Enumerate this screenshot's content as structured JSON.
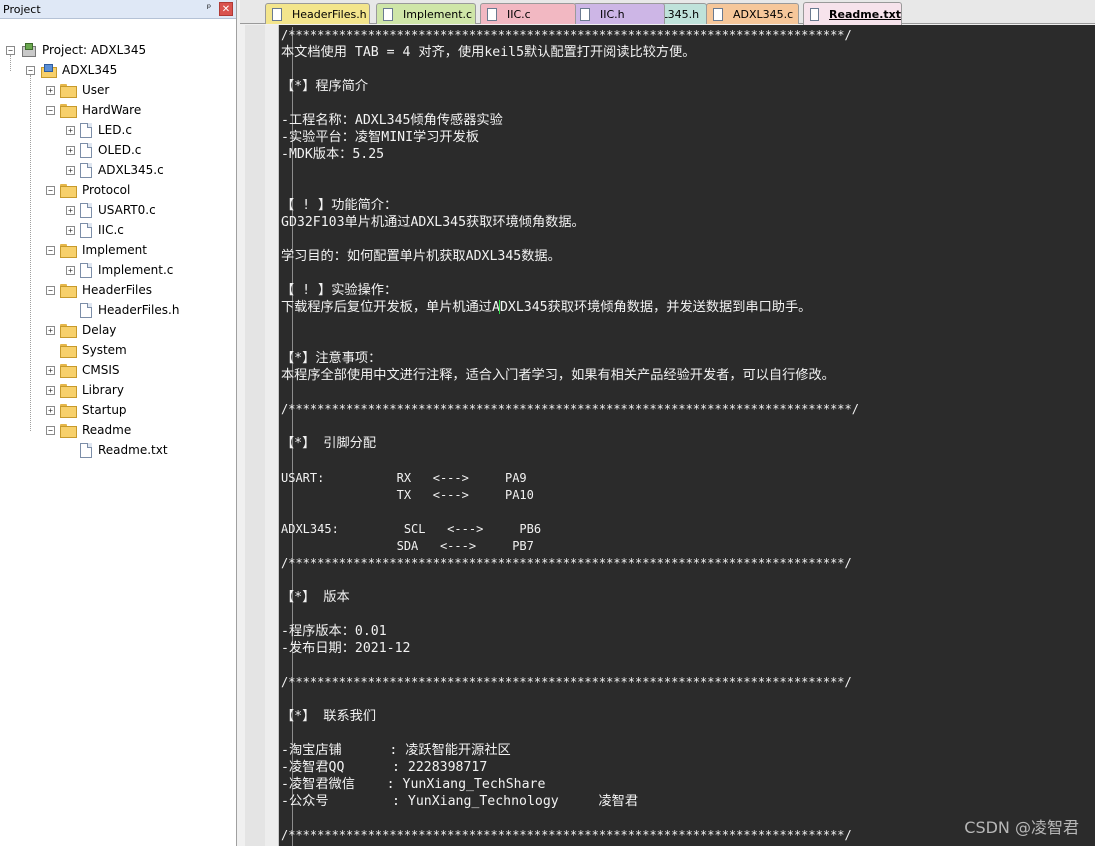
{
  "project_panel": {
    "title": "Project",
    "pin_glyph": "ᵖ",
    "close_glyph": "✕",
    "root_label": "Project: ADXL345",
    "target_label": "ADXL345",
    "groups": [
      {
        "label": "User",
        "state": "collapsed",
        "files": []
      },
      {
        "label": "HardWare",
        "state": "expanded",
        "files": [
          "LED.c",
          "OLED.c",
          "ADXL345.c"
        ]
      },
      {
        "label": "Protocol",
        "state": "expanded",
        "files": [
          "USART0.c",
          "IIC.c"
        ]
      },
      {
        "label": "Implement",
        "state": "expanded",
        "files": [
          "Implement.c"
        ]
      },
      {
        "label": "HeaderFiles",
        "state": "expanded",
        "files": [
          "HeaderFiles.h"
        ]
      },
      {
        "label": "Delay",
        "state": "collapsed",
        "files": []
      },
      {
        "label": "System",
        "state": "none",
        "files": []
      },
      {
        "label": "CMSIS",
        "state": "collapsed",
        "files": []
      },
      {
        "label": "Library",
        "state": "collapsed",
        "files": []
      },
      {
        "label": "Startup",
        "state": "collapsed",
        "files": []
      },
      {
        "label": "Readme",
        "state": "expanded",
        "files": [
          "Readme.txt"
        ]
      }
    ]
  },
  "tabs": [
    {
      "label": "HeaderFiles.h",
      "color": "#f3e58c",
      "active": false
    },
    {
      "label": "Implement.c",
      "color": "#cfe6a8",
      "active": false
    },
    {
      "label": "IIC.c",
      "color": "#f2b8c2",
      "active": false
    },
    {
      "label": "IIC.h",
      "color": "#cdb6e6",
      "active": false
    },
    {
      "label": "ADXL345.h",
      "color": "#bfe2da",
      "active": false
    },
    {
      "label": "ADXL345.c",
      "color": "#f6c79a",
      "active": false
    },
    {
      "label": "Readme.txt",
      "color": "#f7e3ec",
      "active": true
    }
  ],
  "editor": {
    "lines": [
      "/*****************************************************************************/",
      "本文档使用 TAB = 4 对齐，使用keil5默认配置打开阅读比较方便。",
      "",
      "【*】程序简介",
      "",
      "-工程名称：ADXL345倾角传感器实验",
      "-实验平台：凌智MINI学习开发板",
      "-MDK版本：5.25",
      "",
      "",
      "【 ! 】功能简介：",
      "GD32F103单片机通过ADXL345获取环境倾角数据。",
      "",
      "学习目的：如何配置单片机获取ADXL345数据。",
      "",
      "【 ! 】实验操作：",
      "下载程序后复位开发板，单片机通过ADXL345获取环境倾角数据，并发送数据到串口助手。",
      "",
      "",
      "【*】注意事项：",
      "本程序全部使用中文进行注释，适合入门者学习，如果有相关产品经验开发者，可以自行修改。",
      "",
      "/******************************************************************************/",
      "",
      "【*】 引脚分配",
      "",
      "USART:          RX   <--->     PA9",
      "                TX   <--->     PA10",
      "",
      "ADXL345:         SCL   <--->     PB6",
      "                SDA   <--->     PB7",
      "/*****************************************************************************/",
      "",
      "【*】 版本",
      "",
      "-程序版本：0.01",
      "-发布日期：2021-12",
      "",
      "/*****************************************************************************/",
      "",
      "【*】 联系我们",
      "",
      "-淘宝店铺      : 凌跃智能开源社区",
      "-凌智君QQ      : 2228398717",
      "-凌智君微信    : YunXiang_TechShare",
      "-公众号        : YunXiang_Technology     凌智君",
      "",
      "/*****************************************************************************/"
    ],
    "caret_line": 16,
    "caret_after": "下载程序后复位开发板，单片机通过A"
  },
  "watermark": "CSDN @凌智君"
}
